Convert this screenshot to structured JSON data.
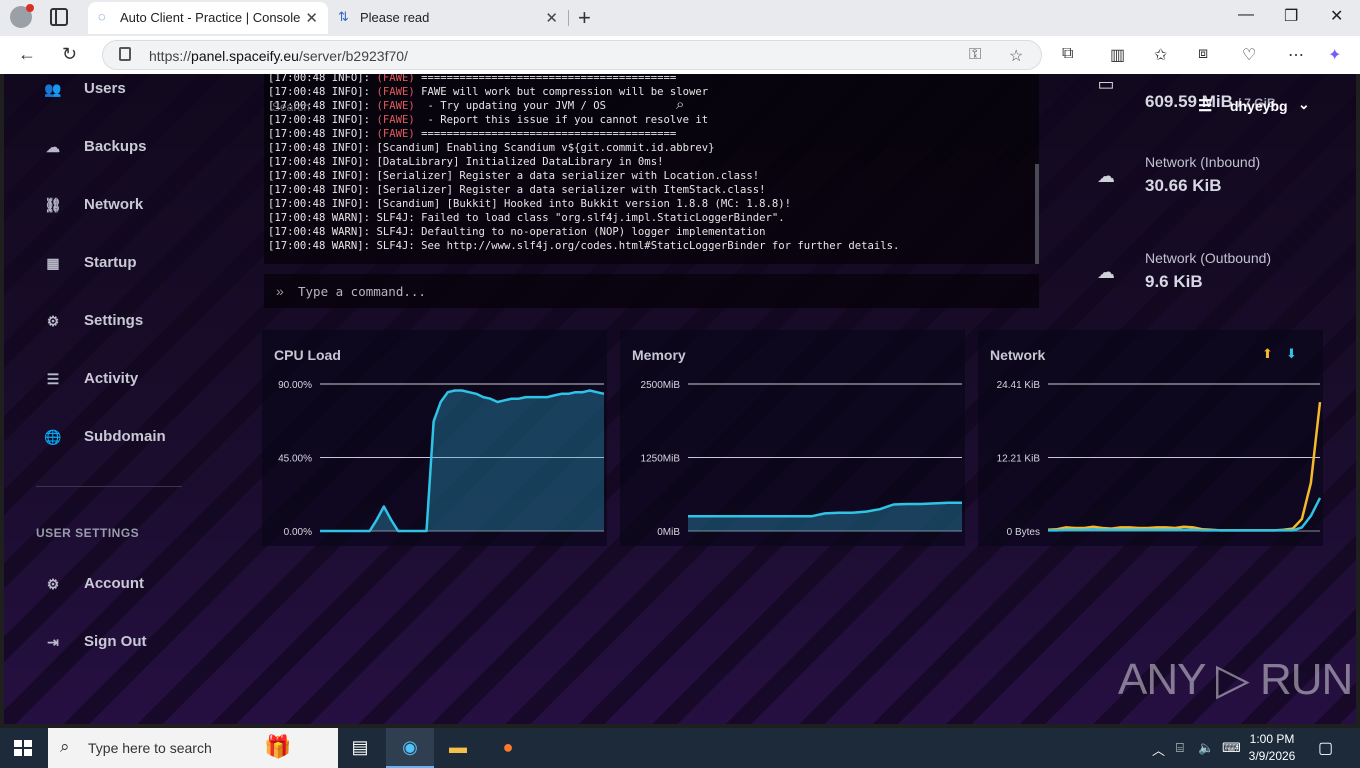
{
  "browser": {
    "tabs": [
      {
        "title": "Auto Client - Practice | Console",
        "active": true
      },
      {
        "title": "Please read",
        "active": false
      }
    ],
    "url_prefix": "https://",
    "url_host": "panel.spaceify.eu",
    "url_path": "/server/b2923f70/"
  },
  "sidebar": {
    "items": [
      {
        "label": "Users",
        "icon": "users-icon"
      },
      {
        "label": "Backups",
        "icon": "cloud-icon"
      },
      {
        "label": "Network",
        "icon": "network-icon"
      },
      {
        "label": "Startup",
        "icon": "chart-icon"
      },
      {
        "label": "Settings",
        "icon": "gears-icon"
      },
      {
        "label": "Activity",
        "icon": "list-icon"
      },
      {
        "label": "Subdomain",
        "icon": "globe-icon"
      }
    ],
    "user_settings_heading": "USER SETTINGS",
    "user_items": [
      {
        "label": "Account",
        "icon": "gears-icon"
      },
      {
        "label": "Sign Out",
        "icon": "sign-out-icon"
      }
    ]
  },
  "console": {
    "search_label": "Search",
    "lines": [
      {
        "prefix": "[17:00:48 INFO]: ",
        "tag": "(FAWE)",
        "text": " ========================================"
      },
      {
        "prefix": "[17:00:48 INFO]: ",
        "tag": "(FAWE)",
        "text": " FAWE will work but compression will be slower"
      },
      {
        "prefix": "[17:00:48 INFO]: ",
        "tag": "(FAWE)",
        "text": "  - Try updating your JVM / OS"
      },
      {
        "prefix": "[17:00:48 INFO]: ",
        "tag": "(FAWE)",
        "text": "  - Report this issue if you cannot resolve it"
      },
      {
        "prefix": "[17:00:48 INFO]: ",
        "tag": "(FAWE)",
        "text": " ========================================"
      },
      {
        "prefix": "[17:00:48 INFO]: ",
        "tag": "",
        "text": "[Scandium] Enabling Scandium v${git.commit.id.abbrev}"
      },
      {
        "prefix": "[17:00:48 INFO]: ",
        "tag": "",
        "text": "[DataLibrary] Initialized DataLibrary in 0ms!"
      },
      {
        "prefix": "[17:00:48 INFO]: ",
        "tag": "",
        "text": "[Serializer] Register a data serializer with Location.class!"
      },
      {
        "prefix": "[17:00:48 INFO]: ",
        "tag": "",
        "text": "[Serializer] Register a data serializer with ItemStack.class!"
      },
      {
        "prefix": "[17:00:48 INFO]: ",
        "tag": "",
        "text": "[Scandium] [Bukkit] Hooked into Bukkit version 1.8.8 (MC: 1.8.8)!"
      },
      {
        "prefix": "[17:00:48 WARN]: ",
        "tag": "",
        "text": "SLF4J: Failed to load class \"org.slf4j.impl.StaticLoggerBinder\"."
      },
      {
        "prefix": "[17:00:48 WARN]: ",
        "tag": "",
        "text": "SLF4J: Defaulting to no-operation (NOP) logger implementation"
      },
      {
        "prefix": "[17:00:48 WARN]: ",
        "tag": "",
        "text": "SLF4J: See http://www.slf4j.org/codes.html#StaticLoggerBinder for further details."
      }
    ],
    "command_placeholder": "Type a command..."
  },
  "stats": {
    "disk_value": "609.59 MiB",
    "disk_limit": "/ 7 GiB",
    "inbound_label": "Network (Inbound)",
    "inbound_value": "30.66 KiB",
    "outbound_label": "Network (Outbound)",
    "outbound_value": "9.6 KiB"
  },
  "user": {
    "name": "dhyeybg"
  },
  "chart_data": [
    {
      "type": "area",
      "title": "CPU Load",
      "x": [
        0,
        1,
        2,
        3,
        4,
        5,
        6,
        7,
        8,
        9,
        10,
        11,
        12,
        13,
        14,
        15,
        16,
        17,
        18,
        19,
        20,
        21,
        22,
        23,
        24,
        25,
        26,
        27,
        28,
        29,
        30,
        31,
        32,
        33,
        34,
        35,
        36,
        37,
        38,
        39,
        40
      ],
      "series": [
        {
          "values": [
            0,
            0,
            0,
            0,
            0,
            0,
            0,
            0,
            7,
            15,
            7,
            0,
            0,
            0,
            0,
            0,
            67,
            79,
            85,
            86,
            86,
            85,
            84,
            82,
            81,
            79,
            80,
            81,
            81,
            82,
            82,
            82,
            82,
            83,
            84,
            84,
            85,
            85,
            86,
            85,
            84
          ]
        }
      ],
      "y_ticks": [
        "0.00%",
        "45.00%",
        "90.00%"
      ],
      "ylim": [
        0,
        90
      ],
      "color": "#2fc3e6"
    },
    {
      "type": "area",
      "title": "Memory",
      "x": [
        0,
        1,
        2,
        3,
        4,
        5,
        6,
        7,
        8,
        9,
        10,
        11,
        12,
        13,
        14,
        15,
        16,
        17,
        18,
        19,
        20
      ],
      "series": [
        {
          "values": [
            250,
            250,
            250,
            250,
            250,
            250,
            250,
            250,
            250,
            250,
            300,
            310,
            310,
            330,
            370,
            450,
            460,
            460,
            470,
            480,
            480
          ]
        }
      ],
      "y_ticks": [
        "0MiB",
        "1250MiB",
        "2500MiB"
      ],
      "ylim": [
        0,
        2500
      ],
      "color": "#2fc3e6"
    },
    {
      "type": "line",
      "title": "Network",
      "x": [
        0,
        1,
        2,
        3,
        4,
        5,
        6,
        7,
        8,
        9,
        10,
        11,
        12,
        13,
        14,
        15,
        16,
        17,
        18,
        19,
        20,
        21,
        22,
        23,
        24,
        25,
        26,
        27,
        28,
        29,
        30
      ],
      "series": [
        {
          "values": [
            0.2,
            0.3,
            0.6,
            0.5,
            0.5,
            0.7,
            0.5,
            0.4,
            0.6,
            0.6,
            0.5,
            0.5,
            0.6,
            0.6,
            0.5,
            0.7,
            0.6,
            0.3,
            0.2,
            0.1,
            0.1,
            0.1,
            0.1,
            0.1,
            0.1,
            0.1,
            0.2,
            0.4,
            2.0,
            8.0,
            21.4
          ],
          "color": "#f5b92e"
        },
        {
          "values": [
            0.1,
            0.1,
            0.2,
            0.2,
            0.2,
            0.3,
            0.2,
            0.2,
            0.2,
            0.2,
            0.2,
            0.2,
            0.2,
            0.2,
            0.2,
            0.2,
            0.2,
            0.1,
            0.1,
            0.1,
            0.1,
            0.1,
            0.1,
            0.1,
            0.1,
            0.1,
            0.1,
            0.1,
            0.6,
            2.5,
            5.5
          ],
          "color": "#2fc3e6"
        }
      ],
      "y_ticks": [
        "0 Bytes",
        "12.21 KiB",
        "24.41 KiB"
      ],
      "ylim": [
        0,
        24.41
      ]
    }
  ],
  "watermark": "ANY ▷ RUN",
  "taskbar": {
    "search_placeholder": "Type here to search",
    "time": "1:00 PM",
    "date": "3/9/2026"
  }
}
